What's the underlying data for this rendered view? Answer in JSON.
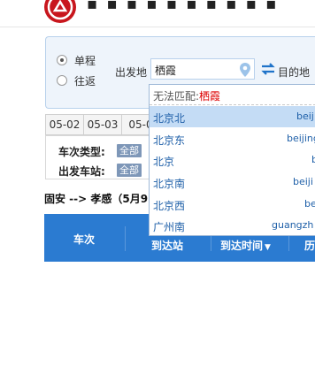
{
  "trip_type": {
    "options": [
      {
        "label": "单程",
        "selected": true
      },
      {
        "label": "往返",
        "selected": false
      }
    ]
  },
  "search": {
    "from_label": "出发地",
    "from_value": "栖霞",
    "to_label": "目的地"
  },
  "date_tabs": [
    "05-02",
    "05-03",
    "05-0"
  ],
  "filters": {
    "train_type_label": "车次类型:",
    "train_type_value": "全部",
    "station_label": "出发车站:",
    "station_value": "全部"
  },
  "route_text": "固安 --> 孝感（5月9",
  "table_header": {
    "train_no": "车次",
    "arrive_station": "到达站",
    "arrive_time": "到达时间",
    "sort_arrow": "▼",
    "partial_last": "历"
  },
  "suggestions": {
    "no_match_prefix": "无法匹配:",
    "no_match_keyword": "栖霞",
    "items": [
      {
        "cn": "北京北",
        "py": "beij",
        "active": true
      },
      {
        "cn": "北京东",
        "py": "beijing",
        "active": false
      },
      {
        "cn": "北京",
        "py": "b",
        "active": false
      },
      {
        "cn": "北京南",
        "py": "beiji",
        "active": false
      },
      {
        "cn": "北京西",
        "py": "be",
        "active": false
      },
      {
        "cn": "广州南",
        "py": "guangzh",
        "active": false
      }
    ]
  },
  "colors": {
    "brand_red": "#c8161d",
    "header_blue": "#2b7bd1",
    "highlight": "#c4dcf5",
    "keyword_red": "#dd0000"
  }
}
